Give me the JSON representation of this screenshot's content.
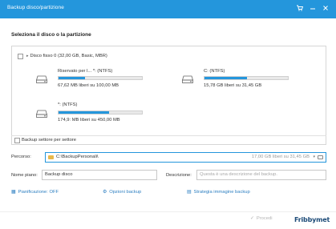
{
  "window": {
    "title": "Backup disco/partizione"
  },
  "heading": "Seleziona il disco o la partizione",
  "disk": {
    "caret": "▸",
    "label": "Disco fisso 0 (32,00 GB, Basic, MBR)"
  },
  "partitions": [
    {
      "name": "Riservato per l... *: (NTFS)",
      "used_fraction": 0.32,
      "info": "67,62 MB liberi su 100,00 MB"
    },
    {
      "name": "C: (NTFS)",
      "used_fraction": 0.51,
      "info": "15,78 GB liberi su 31,45 GB"
    },
    {
      "name": "*: (NTFS)",
      "used_fraction": 0.61,
      "info": "174,9: MB liberi su 450,00 MB"
    }
  ],
  "sector_backup_label": "Backup settore per settore",
  "path": {
    "label": "Percorso:",
    "value": "C:\\BackupPersonali\\",
    "info": "17,00 GB liberi su 31,45 GB"
  },
  "name_field": {
    "label": "Nome piano:",
    "value": "Backup disco"
  },
  "description": {
    "label": "Descrizione:",
    "placeholder": "Questa è una descrizione del backup."
  },
  "options": {
    "schedule": "Pianificazione: OFF",
    "backup_options": "Opzioni backup",
    "image_strategy": "Strategia immagine backup"
  },
  "proceed_label": "Procedi",
  "watermark": "Fribbymet",
  "colors": {
    "accent": "#2496dc",
    "link": "#2d7fc1",
    "folder": "#e8b84a"
  }
}
